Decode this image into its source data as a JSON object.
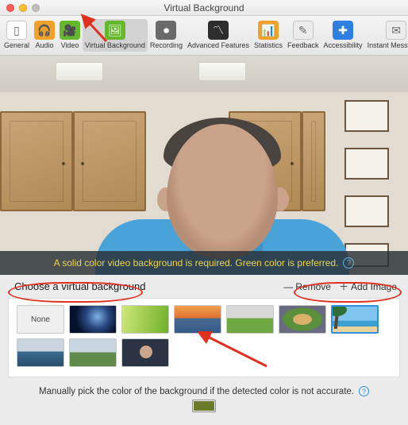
{
  "window": {
    "title": "Virtual Background"
  },
  "toolbar": {
    "items": [
      {
        "label": "General",
        "icon": "phone-icon",
        "color": "#ffffff",
        "glyph": "▯"
      },
      {
        "label": "Audio",
        "icon": "headphones-icon",
        "color": "#f0a12a",
        "glyph": "🎧"
      },
      {
        "label": "Video",
        "icon": "video-icon",
        "color": "#65b72c",
        "glyph": "🎥"
      },
      {
        "label": "Virtual Background",
        "icon": "picture-icon",
        "color": "#65b72c",
        "glyph": "🖼"
      },
      {
        "label": "Recording",
        "icon": "record-icon",
        "color": "#6a6a6a",
        "glyph": "⏺"
      },
      {
        "label": "Advanced Features",
        "icon": "pulse-icon",
        "color": "#2d2d2d",
        "glyph": "〽"
      },
      {
        "label": "Statistics",
        "icon": "stats-icon",
        "color": "#f0a12a",
        "glyph": "📊"
      },
      {
        "label": "Feedback",
        "icon": "feedback-icon",
        "color": "#ececec",
        "glyph": "✎"
      },
      {
        "label": "Accessibility",
        "icon": "accessibility-icon",
        "color": "#2f7fe0",
        "glyph": "✚"
      },
      {
        "label": "Instant Messaging",
        "icon": "chat-icon",
        "color": "#ececec",
        "glyph": "✉"
      }
    ],
    "selected_index": 3
  },
  "banner": {
    "text": "A solid color video background is required. Green color is preferred."
  },
  "section": {
    "title": "Choose a virtual background",
    "remove_label": "Remove",
    "add_label": "Add Image"
  },
  "thumbnails": {
    "none_label": "None",
    "items": [
      {
        "name": "none"
      },
      {
        "name": "earth"
      },
      {
        "name": "grass"
      },
      {
        "name": "golden-gate"
      },
      {
        "name": "stadium-field"
      },
      {
        "name": "baseball-stadium"
      },
      {
        "name": "beach"
      },
      {
        "name": "lake"
      },
      {
        "name": "house"
      },
      {
        "name": "person-headset"
      }
    ],
    "selected_index": 6
  },
  "footer": {
    "text": "Manually pick the color of the background if the detected color is not accurate.",
    "swatch_color": "#6a7b2a"
  }
}
